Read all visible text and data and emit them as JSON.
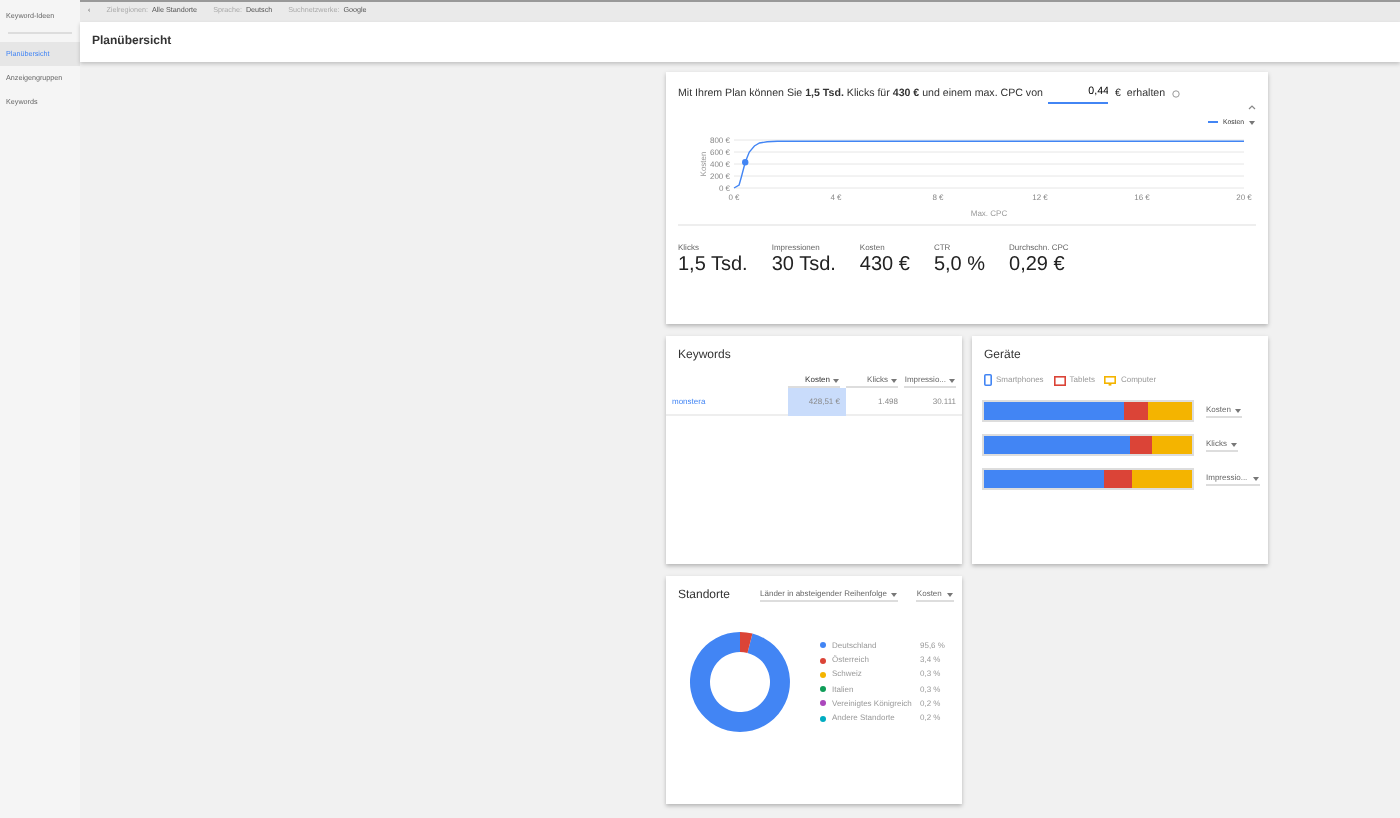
{
  "sidebar": {
    "items": [
      {
        "label": "Keyword-Ideen",
        "selected": false
      },
      {
        "label": "Planübersicht",
        "selected": true
      },
      {
        "label": "Anzeigengruppen",
        "selected": false
      },
      {
        "label": "Keywords",
        "selected": false
      }
    ]
  },
  "filter_bar": {
    "back": "‹",
    "filters": [
      {
        "label": "Zielregionen:",
        "value": "Alle Standorte"
      },
      {
        "label": "Sprache:",
        "value": "Deutsch"
      },
      {
        "label": "Suchnetzwerke:",
        "value": "Google"
      }
    ]
  },
  "page_title": "Planübersicht",
  "plan": {
    "sentence": "Mit Ihrem Plan können Sie **1,5 Tsd.** Klicks für **430 €** und einem max. CPC von",
    "cpc_value": "0,44",
    "currency": "€",
    "suffix": "erhalten",
    "chart_data": {
      "type": "line",
      "xlabel": "Max. CPC",
      "ylabel": "Kosten",
      "x": [
        0,
        0.2,
        0.3,
        0.44,
        0.6,
        0.8,
        1,
        1.3,
        1.7,
        2.2,
        3,
        4,
        8,
        12,
        16,
        20
      ],
      "series": [
        {
          "name": "Kosten",
          "color": "#4285f4",
          "values": [
            0,
            50,
            200,
            430,
            600,
            700,
            750,
            770,
            780,
            780,
            780,
            780,
            780,
            780,
            780,
            780
          ]
        }
      ],
      "grid": true,
      "xlim": [
        0,
        20
      ],
      "ylim": [
        0,
        800
      ],
      "xticks": [
        {
          "value": 0,
          "label": "0 €"
        },
        {
          "value": 4,
          "label": "4 €"
        },
        {
          "value": 8,
          "label": "8 €"
        },
        {
          "value": 12,
          "label": "12 €"
        },
        {
          "value": 16,
          "label": "16 €"
        },
        {
          "value": 20,
          "label": "20 €"
        }
      ],
      "yticks": [
        {
          "value": 0,
          "label": "0 €"
        },
        {
          "value": 200,
          "label": "200 €"
        },
        {
          "value": 400,
          "label": "400 €"
        },
        {
          "value": 600,
          "label": "600 €"
        },
        {
          "value": 800,
          "label": "800 €"
        }
      ]
    },
    "stats": [
      {
        "label": "Klicks",
        "value": "1,5 Tsd."
      },
      {
        "label": "Impressionen",
        "value": "30 Tsd."
      },
      {
        "label": "Kosten",
        "value": "430 €"
      },
      {
        "label": "CTR",
        "value": "5,0 %"
      },
      {
        "label": "Durchschn. CPC",
        "value": "0,29 €"
      }
    ]
  },
  "keywords": {
    "title": "Keywords",
    "columns": [
      {
        "label": "Kosten",
        "sorted": true
      },
      {
        "label": "Klicks",
        "sorted": false
      },
      {
        "label": "Impressio...",
        "sorted": false
      }
    ],
    "rows": [
      {
        "keyword": "monstera",
        "cells": [
          "428,51 €",
          "1.498",
          "30.111"
        ]
      }
    ]
  },
  "devices": {
    "title": "Geräte",
    "legend": [
      {
        "kind": "phone",
        "label": "Smartphones",
        "color": "#4285f4"
      },
      {
        "kind": "tablet",
        "label": "Tablets",
        "color": "#db4437"
      },
      {
        "kind": "computer",
        "label": "Computer",
        "color": "#f4b400"
      }
    ],
    "bars": [
      {
        "metric": "Kosten"
      },
      {
        "metric": "Klicks"
      },
      {
        "metric": "Impressio..."
      }
    ]
  },
  "locations": {
    "title": "Standorte",
    "sort_dropdown": "Länder in absteigender Reihenfolge",
    "metric_dropdown": "Kosten",
    "legend": [
      {
        "label": "Deutschland",
        "share": "95,6 %",
        "color": "#4285f4"
      },
      {
        "label": "Österreich",
        "share": "3,4 %",
        "color": "#db4437"
      },
      {
        "label": "Schweiz",
        "share": "0,3 %",
        "color": "#f4b400"
      },
      {
        "label": "Italien",
        "share": "0,3 %",
        "color": "#0f9d58"
      },
      {
        "label": "Vereinigtes Königreich",
        "share": "0,2 %",
        "color": "#ab47bc"
      },
      {
        "label": "Andere Standorte",
        "share": "0,2 %",
        "color": "#00acc1"
      }
    ]
  }
}
